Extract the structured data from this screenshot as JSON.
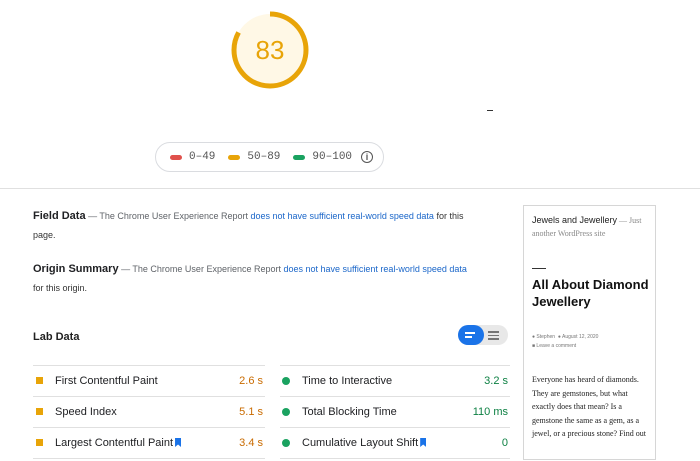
{
  "score": {
    "value": "83",
    "fraction": 0.83,
    "color": "#e8a408"
  },
  "legend": {
    "items": [
      {
        "label": "0–49",
        "color": "#e0504b"
      },
      {
        "label": "50–89",
        "color": "#e8a408"
      },
      {
        "label": "90–100",
        "color": "#1aa260"
      }
    ],
    "info_icon": "info-icon"
  },
  "field_data": {
    "title": "Field Data",
    "prefix": " — The Chrome User Experience Report ",
    "link": "does not have sufficient real-world speed data",
    "suffix": " for this page."
  },
  "origin_summary": {
    "title": "Origin Summary",
    "prefix": " — The Chrome User Experience Report ",
    "link": "does not have sufficient real-world speed data",
    "suffix": " for this origin."
  },
  "lab_data": {
    "title": "Lab Data",
    "toggle_icons": [
      "expanded-view-icon",
      "list-view-icon"
    ],
    "metrics_left": [
      {
        "label": "First Contentful Paint",
        "value": "2.6 s",
        "color": "#c96b00"
      },
      {
        "label": "Speed Index",
        "value": "5.1 s",
        "color": "#c96b00"
      },
      {
        "label": "Largest Contentful Paint",
        "value": "3.4 s",
        "color": "#c96b00"
      }
    ],
    "metrics_right": [
      {
        "label": "Time to Interactive",
        "value": "3.2 s",
        "color": "#0d8043"
      },
      {
        "label": "Total Blocking Time",
        "value": "110 ms",
        "color": "#0d8043"
      },
      {
        "label": "Cumulative Layout Shift",
        "value": "0",
        "color": "#0d8043"
      }
    ]
  },
  "screenshot": {
    "site_title": "Jewels and Jewellery",
    "tagline": " — Just another WordPress site",
    "post_title": "All About Diamond Jewellery",
    "author": "Stephen",
    "date": "August 12, 2020",
    "comment": "Leave a comment",
    "excerpt": "Everyone has heard of diamonds. They are gemstones, but what exactly does that mean? Is a gemstone the same as a gem, as a jewel, or a precious stone? Find out"
  }
}
